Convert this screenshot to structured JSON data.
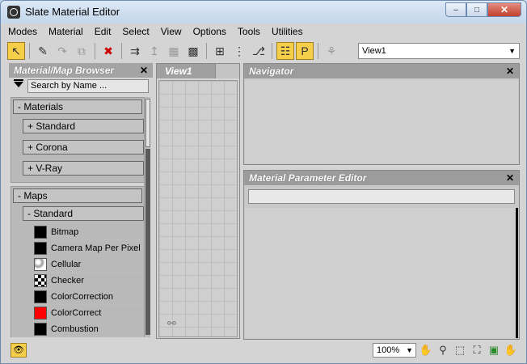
{
  "window": {
    "title": "Slate Material Editor",
    "controls": {
      "minimize": "–",
      "maximize": "□",
      "close": "✕"
    }
  },
  "menu": [
    "Modes",
    "Material",
    "Edit",
    "Select",
    "View",
    "Options",
    "Tools",
    "Utilities"
  ],
  "toolbar": {
    "icons": [
      {
        "name": "select-arrow-icon",
        "glyph": "↖",
        "active": true
      },
      {
        "name": "pick-material-icon",
        "glyph": "✎"
      },
      {
        "name": "put-to-scene-icon",
        "glyph": "↷",
        "dim": true
      },
      {
        "name": "assign-to-selection-icon",
        "glyph": "⧉",
        "dim": true
      },
      {
        "name": "delete-icon",
        "glyph": "✖",
        "color": "#cc0000"
      },
      {
        "name": "move-children-icon",
        "glyph": "⇉"
      },
      {
        "name": "show-background-icon",
        "glyph": "↥",
        "dim": true
      },
      {
        "name": "show-map-icon",
        "glyph": "▦",
        "dim": true
      },
      {
        "name": "checker-background-icon",
        "glyph": "▩"
      },
      {
        "name": "layout-all-icon",
        "glyph": "⊞"
      },
      {
        "name": "layout-vertical-icon",
        "glyph": "⋮"
      },
      {
        "name": "layout-children-icon",
        "glyph": "⎇"
      },
      {
        "name": "material-map-browser-icon",
        "glyph": "☷",
        "active": true
      },
      {
        "name": "parameter-editor-icon",
        "glyph": "P",
        "active": true
      },
      {
        "name": "select-by-material-icon",
        "glyph": "⚘",
        "dim": true
      }
    ],
    "view_select": "View1"
  },
  "browser": {
    "title": "Material/Map Browser",
    "search_placeholder": "Search by Name ...",
    "materials_label": "- Materials",
    "material_groups": [
      "+ Standard",
      "+ Corona",
      "+ V-Ray"
    ],
    "maps_label": "- Maps",
    "maps_sub_label": "- Standard",
    "maps": [
      {
        "label": "Bitmap",
        "swatch": "#000000"
      },
      {
        "label": "Camera Map Per Pixel",
        "swatch": "#000000"
      },
      {
        "label": "Cellular",
        "swatch": "cellular"
      },
      {
        "label": "Checker",
        "swatch": "checker"
      },
      {
        "label": "ColorCorrection",
        "swatch": "#000000"
      },
      {
        "label": "ColorCorrect",
        "swatch": "#ff0000"
      },
      {
        "label": "Combustion",
        "swatch": "#000000"
      }
    ]
  },
  "view1": {
    "tab_label": "View1"
  },
  "navigator": {
    "title": "Navigator"
  },
  "parameter_editor": {
    "title": "Material Parameter Editor"
  },
  "status": {
    "zoom": "100%"
  },
  "colors": {
    "accent_yellow": "#f5cf4a",
    "delete_red": "#cc0000"
  }
}
